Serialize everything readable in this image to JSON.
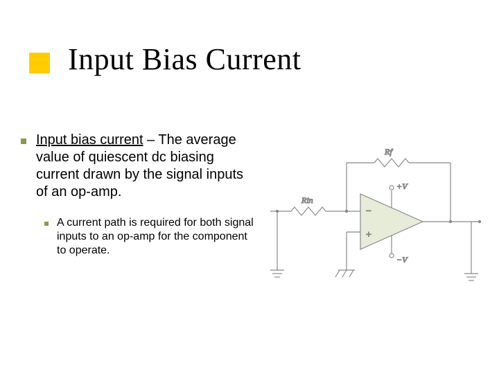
{
  "title": "Input Bias Current",
  "bullet": {
    "term": "Input bias current",
    "definition": " – The average value of quiescent dc biasing current drawn by the signal inputs of an op-amp."
  },
  "sub_bullet": "A current path is required for both signal inputs to an op-amp for the component to operate.",
  "figure": {
    "r_in": "Rin",
    "r_f": "Rf",
    "plus_v": "+V",
    "minus_v": "−V",
    "minus": "−",
    "plus": "+"
  }
}
